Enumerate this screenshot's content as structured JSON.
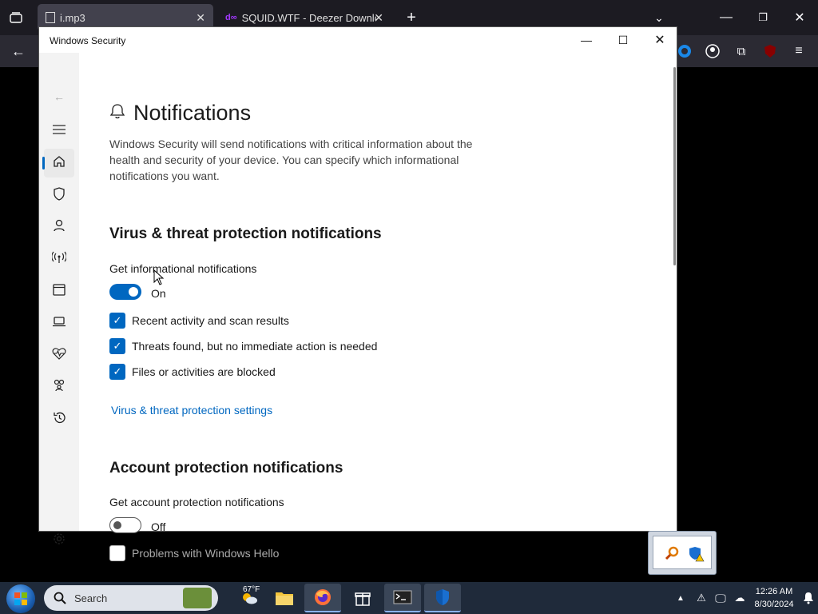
{
  "browser": {
    "tabs": [
      {
        "label": "i.mp3"
      },
      {
        "label": "SQUID.WTF - Deezer Downloader"
      }
    ],
    "new_tab_label": "+"
  },
  "window": {
    "title": "Windows Security",
    "controls": {
      "minimize": "—",
      "maximize": "☐",
      "close": "✕"
    }
  },
  "page": {
    "title": "Notifications",
    "description": "Windows Security will send notifications with critical information about the health and security of your device. You can specify which informational notifications you want.",
    "sections": [
      {
        "heading": "Virus & threat protection notifications",
        "toggle_label": "Get informational notifications",
        "toggle_state": "On",
        "checkboxes": [
          {
            "label": "Recent activity and scan results",
            "checked": true
          },
          {
            "label": "Threats found, but no immediate action is needed",
            "checked": true
          },
          {
            "label": "Files or activities are blocked",
            "checked": true
          }
        ],
        "link": "Virus & threat protection settings"
      },
      {
        "heading": "Account protection notifications",
        "toggle_label": "Get account protection notifications",
        "toggle_state": "Off",
        "checkboxes": [
          {
            "label": "Problems with Windows Hello",
            "checked": false
          }
        ]
      }
    ]
  },
  "taskbar": {
    "search_placeholder": "Search",
    "weather": "67°F",
    "clock_time": "12:26 AM",
    "clock_date": "8/30/2024"
  },
  "colors": {
    "accent": "#0067c0",
    "taskbar": "#1f2a3a",
    "browser_bg": "#1c1b22"
  }
}
